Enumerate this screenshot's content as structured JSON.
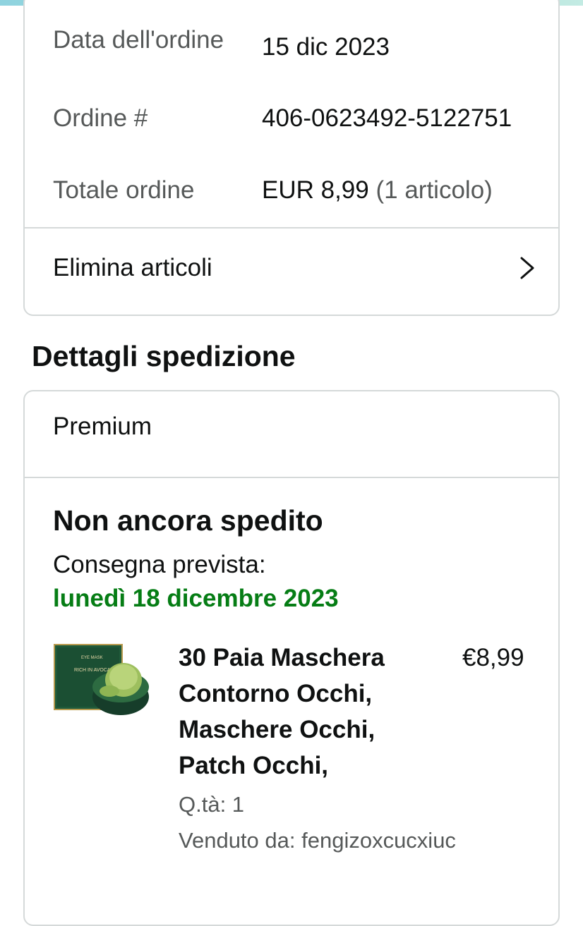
{
  "order_summary": {
    "date_label": "Data dell'ordine",
    "date_value": "15 dic 2023",
    "order_label": "Ordine #",
    "order_value": "406-0623492-5122751",
    "total_label": "Totale ordine",
    "total_value": "EUR 8,99",
    "total_items": "(1 articolo)",
    "delete_items_label": "Elimina articoli"
  },
  "shipment": {
    "section_title": "Dettagli spedizione",
    "method": "Premium",
    "status": "Non ancora spedito",
    "estimated_label": "Consegna prevista:",
    "estimated_date": "lunedì 18 dicembre 2023",
    "item": {
      "title": "30 Paia Maschera Contorno Occhi, Maschere Occhi, Patch Occhi,",
      "price": "€8,99",
      "quantity": "Q.tà: 1",
      "seller": "Venduto da: fengizoxcucxiuc",
      "box_text_1": "EYE MASK",
      "box_text_2": "RICH IN AVOCADO"
    }
  },
  "colors": {
    "delivery_date_green": "#067d15",
    "border": "#d5d9d9",
    "muted_text": "#565959"
  }
}
